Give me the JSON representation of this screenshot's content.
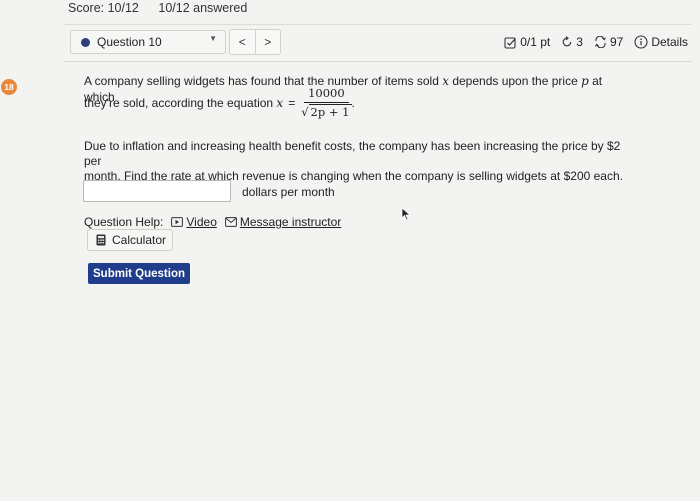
{
  "header": {
    "score": "Score: 10/12",
    "answered": "10/12 answered"
  },
  "side_badge": "18",
  "question_nav": {
    "selected": "Question 10",
    "prev": "<",
    "next": ">"
  },
  "status": {
    "points": "0/1 pt",
    "retries": "3",
    "attempts": "97",
    "details": "Details"
  },
  "question": {
    "line1_a": "A company selling widgets has found that the number of items sold ",
    "var_x": "x",
    "line1_b": " depends upon the price ",
    "var_p": "p",
    "line1_c": " at which",
    "line2": "they're sold, according the equation ",
    "eq_var": "x",
    "eq_sign": "=",
    "numerator": "10000",
    "denominator_sqrt": "√",
    "denominator_expr": "2p + 1",
    "period": ".",
    "para2_line1": "Due to inflation and increasing health benefit costs, the company has been increasing the price by $2 per",
    "para2_line2": "month. Find the rate at which revenue is changing when the company is selling widgets at $200 each."
  },
  "answer": {
    "value": "",
    "units": "dollars per month"
  },
  "help": {
    "label": "Question Help:",
    "video": "Video",
    "message": "Message instructor",
    "calculator": "Calculator"
  },
  "submit_label": "Submit Question",
  "colors": {
    "primary": "#1f3d8a",
    "badge": "#e8893a",
    "question_dot": "#2c3f78"
  }
}
